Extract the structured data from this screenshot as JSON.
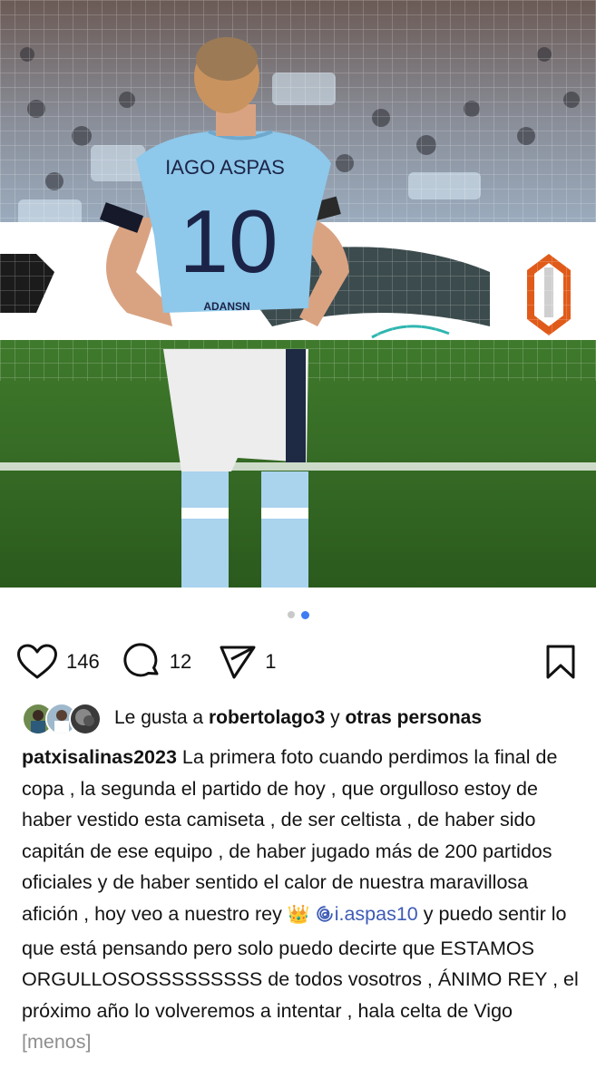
{
  "carousel": {
    "count": 2,
    "active_index": 1
  },
  "actions": {
    "likes_count": "146",
    "comments_count": "12",
    "shares_count": "1",
    "icons": [
      "heart-icon",
      "comment-icon",
      "share-icon",
      "bookmark-icon"
    ]
  },
  "liked_by": {
    "prefix": "Le gusta a",
    "user": "robertolago3",
    "connector": "y",
    "others": "otras personas"
  },
  "caption": {
    "username": "patxisalinas2023",
    "text_part1": "La primera foto cuando perdimos la final de copa , la segunda el partido de hoy , que orgulloso estoy de haber vestido esta camiseta , de ser celtista , de haber sido capitán de ese equipo , de haber jugado más de 200 partidos oficiales y de haber sentido el calor de nuestra maravillosa afición , hoy veo a nuestro rey",
    "crown_emoji": "👑",
    "mention": "i.aspas10",
    "text_part2": "y puedo sentir lo que está pensando pero solo puedo decirte que ESTAMOS ORGULLOSOSSSSSSSSS de todos vosotros , ÁNIMO REY , el próximo año lo volveremos a intentar , hala celta de Vigo",
    "less_label": "[menos]"
  },
  "photo": {
    "jersey_name": "IAGO ASPAS",
    "jersey_number": "10",
    "jersey_sponsor": "ADANSN"
  },
  "colors": {
    "accent_blue": "#3d7cf2",
    "mention_blue": "#3d5bb6",
    "celta_sky": "#8ec8ea"
  }
}
